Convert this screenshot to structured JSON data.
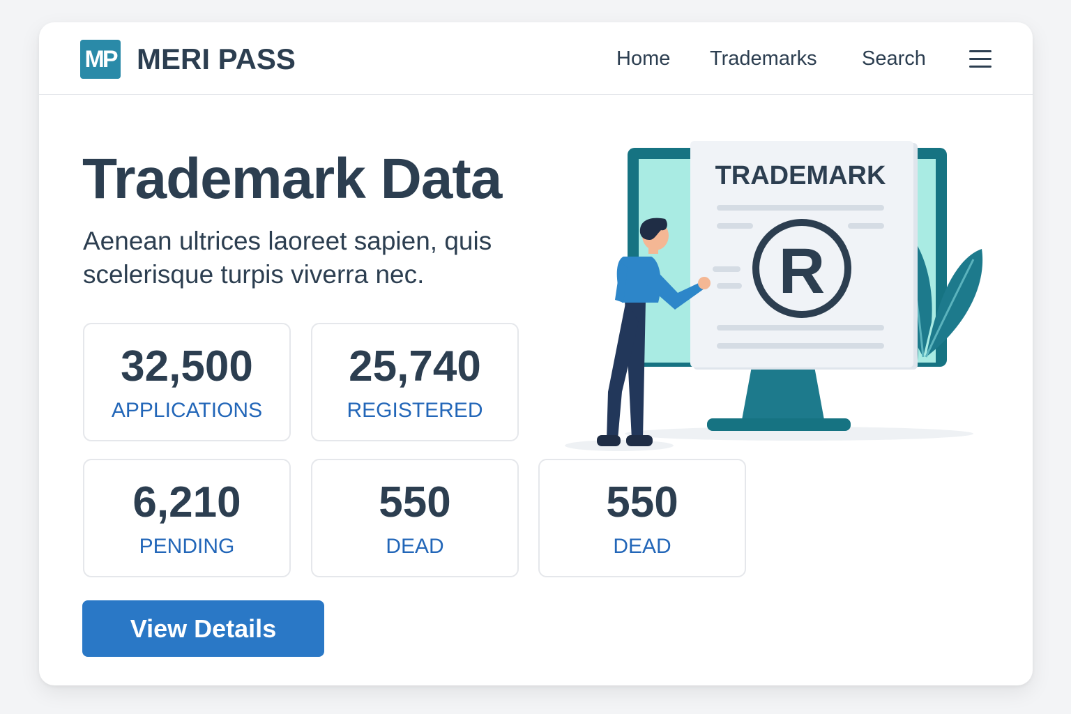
{
  "header": {
    "logo_text": "MP",
    "brand": "MERI PASS",
    "nav": [
      "Home",
      "Trademarks",
      "Search"
    ]
  },
  "main": {
    "title": "Trademark Data",
    "subtitle": "Aenean ultrices laoreet sapien, quis scelerisque turpis viverra nec.",
    "stats": [
      {
        "value": "32,500",
        "label": "APPLICATIONS"
      },
      {
        "value": "25,740",
        "label": "REGISTERED"
      },
      {
        "value": "6,210",
        "label": "PENDING"
      },
      {
        "value": "550",
        "label": "DEAD"
      },
      {
        "value": "550",
        "label": "DEAD"
      }
    ],
    "button_label": "View Details"
  },
  "illustration": {
    "document_heading": "TRADEMARK",
    "symbol": "R"
  },
  "colors": {
    "primary": "#2a78c6",
    "text": "#2c3e50",
    "label": "#2266b8",
    "teal": "#167382",
    "screen": "#a9ebe3"
  }
}
